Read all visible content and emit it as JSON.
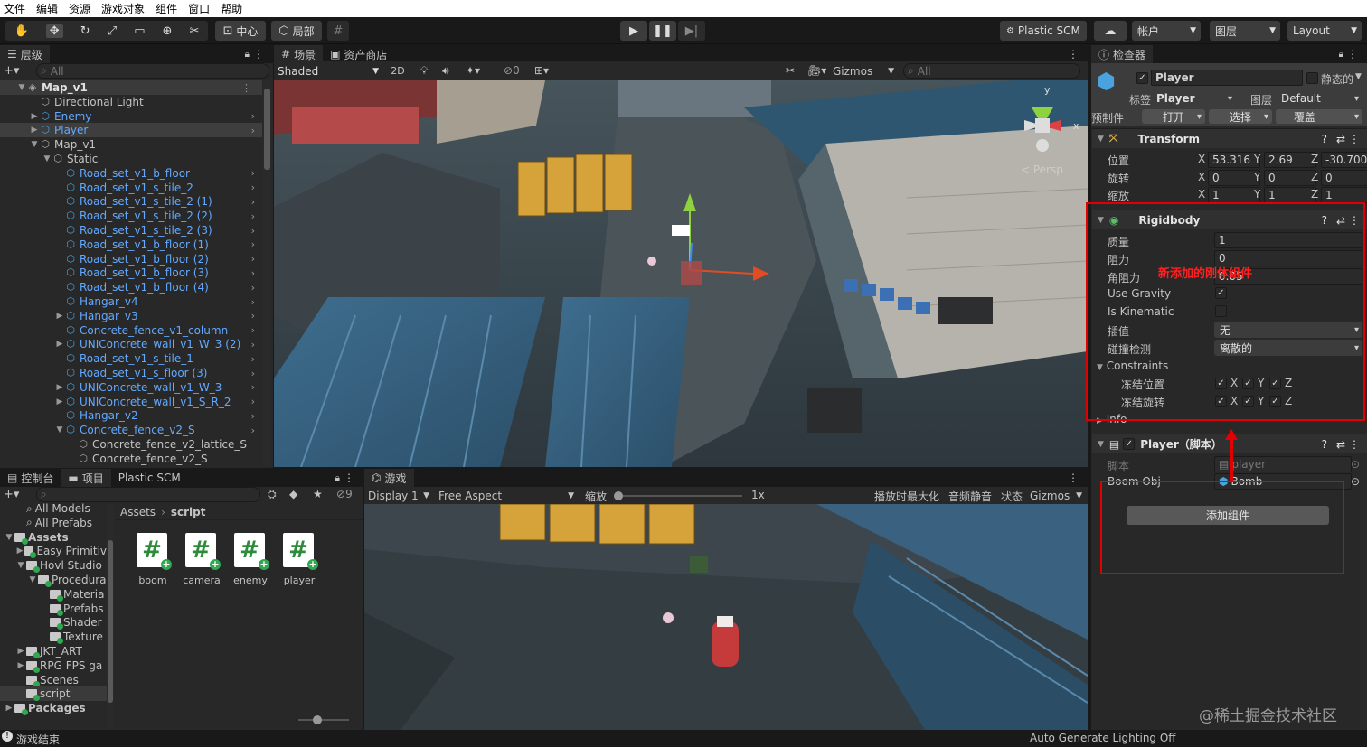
{
  "menu": [
    "文件",
    "编辑",
    "资源",
    "游戏对象",
    "组件",
    "窗口",
    "帮助"
  ],
  "toolbar": {
    "pivot_label": "中心",
    "space_label": "局部",
    "plastic_scm": "Plastic SCM",
    "account": "帐户",
    "layers": "图层",
    "layout": "Layout"
  },
  "hierarchy": {
    "tab": "层级",
    "search_placeholder": "All",
    "items": [
      {
        "label": "Map_v1",
        "type": "scene"
      },
      {
        "label": "Directional Light",
        "type": "object"
      },
      {
        "label": "Enemy",
        "type": "prefab"
      },
      {
        "label": "Player",
        "type": "prefab"
      },
      {
        "label": "Map_v1",
        "type": "object"
      },
      {
        "label": "Static",
        "type": "object"
      },
      {
        "label": "Road_set_v1_b_floor",
        "type": "prefab"
      },
      {
        "label": "Road_set_v1_s_tile_2",
        "type": "prefab"
      },
      {
        "label": "Road_set_v1_s_tile_2 (1)",
        "type": "prefab"
      },
      {
        "label": "Road_set_v1_s_tile_2 (2)",
        "type": "prefab"
      },
      {
        "label": "Road_set_v1_s_tile_2 (3)",
        "type": "prefab"
      },
      {
        "label": "Road_set_v1_b_floor (1)",
        "type": "prefab"
      },
      {
        "label": "Road_set_v1_b_floor (2)",
        "type": "prefab"
      },
      {
        "label": "Road_set_v1_b_floor (3)",
        "type": "prefab"
      },
      {
        "label": "Road_set_v1_b_floor (4)",
        "type": "prefab"
      },
      {
        "label": "Hangar_v4",
        "type": "prefab"
      },
      {
        "label": "Hangar_v3",
        "type": "prefab"
      },
      {
        "label": "Concrete_fence_v1_column",
        "type": "prefab"
      },
      {
        "label": "UNIConcrete_wall_v1_W_3 (2)",
        "type": "prefab"
      },
      {
        "label": "Road_set_v1_s_tile_1",
        "type": "prefab"
      },
      {
        "label": "Road_set_v1_s_floor (3)",
        "type": "prefab"
      },
      {
        "label": "UNIConcrete_wall_v1_W_3",
        "type": "prefab"
      },
      {
        "label": "UNIConcrete_wall_v1_S_R_2",
        "type": "prefab"
      },
      {
        "label": "Hangar_v2",
        "type": "prefab"
      },
      {
        "label": "Concrete_fence_v2_S",
        "type": "prefab"
      },
      {
        "label": "Concrete_fence_v2_lattice_S",
        "type": "object"
      },
      {
        "label": "Concrete_fence_v2_S",
        "type": "object"
      }
    ]
  },
  "scene": {
    "tab_scene": "场景",
    "tab_store": "资产商店",
    "shading": "Shaded",
    "mode_2d": "2D",
    "hidden_count": "0",
    "gizmos": "Gizmos",
    "search_placeholder": "All",
    "persp": "< Persp",
    "axis_y": "y",
    "axis_x": "x"
  },
  "inspector": {
    "tab": "检查器",
    "object_name": "Player",
    "static_label": "静态的",
    "tag_label": "标签",
    "tag_value": "Player",
    "layer_label": "图层",
    "layer_value": "Default",
    "prefab_label": "预制件",
    "open_btn": "打开",
    "select_btn": "选择",
    "override_btn": "覆盖",
    "transform": {
      "title": "Transform",
      "position_label": "位置",
      "rotation_label": "旋转",
      "scale_label": "缩放",
      "pos": [
        "53.316",
        "2.69",
        "-30.700"
      ],
      "rot": [
        "0",
        "0",
        "0"
      ],
      "scl": [
        "1",
        "1",
        "1"
      ]
    },
    "rigidbody": {
      "title": "Rigidbody",
      "mass_label": "质量",
      "mass": "1",
      "drag_label": "阻力",
      "drag": "0",
      "angular_label": "角阻力",
      "angular": "0.05",
      "gravity_label": "Use Gravity",
      "kinematic_label": "Is Kinematic",
      "interp_label": "插值",
      "interp": "无",
      "collision_label": "碰撞检测",
      "collision": "离散的",
      "constraints_label": "Constraints",
      "freeze_pos_label": "冻结位置",
      "freeze_rot_label": "冻结旋转",
      "info_label": "Info",
      "annotation": "新添加的刚体组件"
    },
    "player_script": {
      "title": "Player（脚本）",
      "script_label": "脚本",
      "script_value": "player",
      "boom_label": "Boom Obj",
      "boom_value": "Bomb"
    },
    "add_component": "添加组件",
    "axes": [
      "X",
      "Y",
      "Z"
    ]
  },
  "project": {
    "tab_console": "控制台",
    "tab_project": "项目",
    "tab_plastic": "Plastic SCM",
    "lock_count": "9",
    "tree": [
      {
        "label": "All Models",
        "indent": 1
      },
      {
        "label": "All Prefabs",
        "indent": 1
      },
      {
        "label": "Assets",
        "indent": 0,
        "bold": true
      },
      {
        "label": "Easy Primitiv",
        "indent": 1
      },
      {
        "label": "Hovl Studio",
        "indent": 1
      },
      {
        "label": "Procedura",
        "indent": 2
      },
      {
        "label": "Materia",
        "indent": 3
      },
      {
        "label": "Prefabs",
        "indent": 3
      },
      {
        "label": "Shader",
        "indent": 3
      },
      {
        "label": "Texture",
        "indent": 3
      },
      {
        "label": "JKT_ART",
        "indent": 1
      },
      {
        "label": "RPG FPS ga",
        "indent": 1
      },
      {
        "label": "Scenes",
        "indent": 1
      },
      {
        "label": "script",
        "indent": 1
      },
      {
        "label": "Packages",
        "indent": 0,
        "bold": true
      }
    ],
    "breadcrumb_root": "Assets",
    "breadcrumb_leaf": "script",
    "files": [
      "boom",
      "camera",
      "enemy",
      "player"
    ]
  },
  "game": {
    "tab": "游戏",
    "display": "Display 1",
    "aspect": "Free Aspect",
    "scale_label": "缩放",
    "scale_value": "1x",
    "maximize": "播放时最大化",
    "mute": "音频静音",
    "stats": "状态",
    "gizmos": "Gizmos"
  },
  "status": {
    "left": "游戏结束",
    "right": "Auto Generate Lighting Off"
  },
  "watermark": "@稀土掘金技术社区"
}
